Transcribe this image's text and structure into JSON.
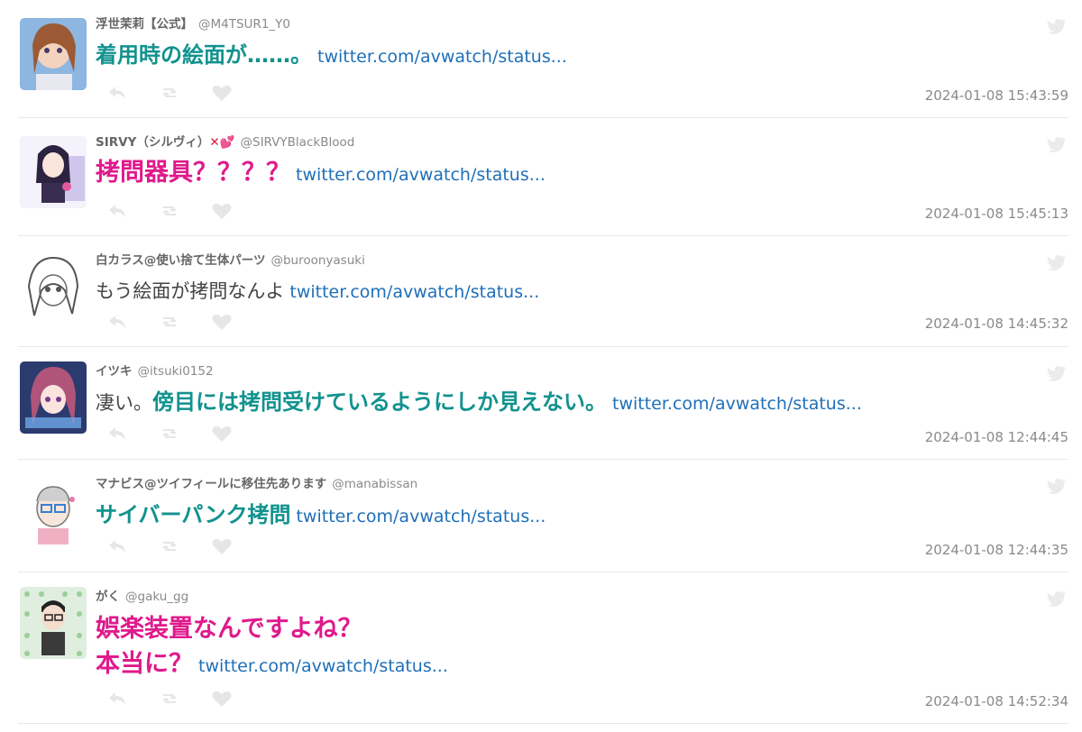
{
  "tweets": [
    {
      "name": "浮世茉莉【公式】",
      "handle": "@M4TSUR1_Y0",
      "segments": [
        {
          "style": "em-teal",
          "text": "着用時の絵面が……。"
        }
      ],
      "link": "twitter.com/avwatch/status...",
      "time": "2024-01-08 15:43:59"
    },
    {
      "name": "SIRVY（シルヴィ）",
      "name_suffix": "✕💕",
      "handle": "@SIRVYBlackBlood",
      "segments": [
        {
          "style": "em-pink",
          "text": "拷問器具？？？？"
        }
      ],
      "link": "twitter.com/avwatch/status...",
      "time": "2024-01-08 15:45:13"
    },
    {
      "name": "白カラス@使い捨て生体パーツ",
      "handle": "@buroonyasuki",
      "segments": [
        {
          "style": "plain",
          "text": "もう絵面が拷問なんよ"
        }
      ],
      "link": "twitter.com/avwatch/status...",
      "time": "2024-01-08 14:45:32"
    },
    {
      "name": "イツキ",
      "handle": "@itsuki0152",
      "segments": [
        {
          "style": "plain",
          "text": "凄い。"
        },
        {
          "style": "em-teal",
          "text": "傍目には拷問受けているようにしか見えない。"
        }
      ],
      "link": "twitter.com/avwatch/status...",
      "time": "2024-01-08 12:44:45"
    },
    {
      "name": "マナビス@ツイフィールに移住先あります",
      "handle": "@manabissan",
      "segments": [
        {
          "style": "em-teal",
          "text": "サイバーパンク拷問"
        }
      ],
      "link": "twitter.com/avwatch/status...",
      "time": "2024-01-08 12:44:35"
    },
    {
      "name": "がく",
      "handle": "@gaku_gg",
      "segments": [
        {
          "style": "em-pink",
          "text": "娯楽装置なんですよね？"
        }
      ],
      "segments2": [
        {
          "style": "em-pink",
          "text": "本当に？"
        }
      ],
      "link": "twitter.com/avwatch/status...",
      "time": "2024-01-08 14:52:34"
    }
  ],
  "icons": {
    "reply": "reply-icon",
    "retweet": "retweet-icon",
    "like": "heart-icon",
    "source": "twitter-bird-icon"
  },
  "colors": {
    "teal": "#11928e",
    "pink": "#e0198c",
    "link": "#1f6fb8",
    "meta": "#8a8a8a"
  }
}
